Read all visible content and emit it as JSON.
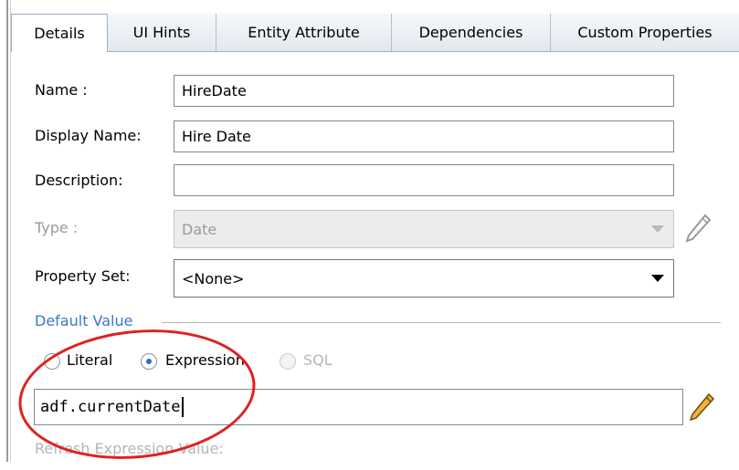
{
  "tabs": [
    {
      "label": "Details",
      "active": true
    },
    {
      "label": "UI Hints",
      "active": false
    },
    {
      "label": "Entity Attribute",
      "active": false
    },
    {
      "label": "Dependencies",
      "active": false
    },
    {
      "label": "Custom Properties",
      "active": false
    }
  ],
  "form": {
    "name_label": "Name :",
    "name_value": "HireDate",
    "display_name_label": "Display Name:",
    "display_name_value": "Hire Date",
    "description_label": "Description:",
    "description_value": "",
    "type_label": "Type :",
    "type_value": "Date",
    "type_disabled": true,
    "property_set_label": "Property Set:",
    "property_set_value": "<None>"
  },
  "default_value": {
    "section_title": "Default Value",
    "options": [
      {
        "label": "Literal",
        "checked": false,
        "disabled": false
      },
      {
        "label": "Expression",
        "checked": true,
        "disabled": false
      },
      {
        "label": "SQL",
        "checked": false,
        "disabled": true
      }
    ],
    "expression": "adf.currentDate",
    "refresh_label": "Refresh Expression Value:"
  },
  "colors": {
    "accent": "#3a78c7",
    "highlight_oval": "#e02020",
    "edit_pencil": "#e0a020"
  },
  "icons": [
    "pencil-icon",
    "pencil-edit-icon",
    "chevron-down-icon"
  ]
}
